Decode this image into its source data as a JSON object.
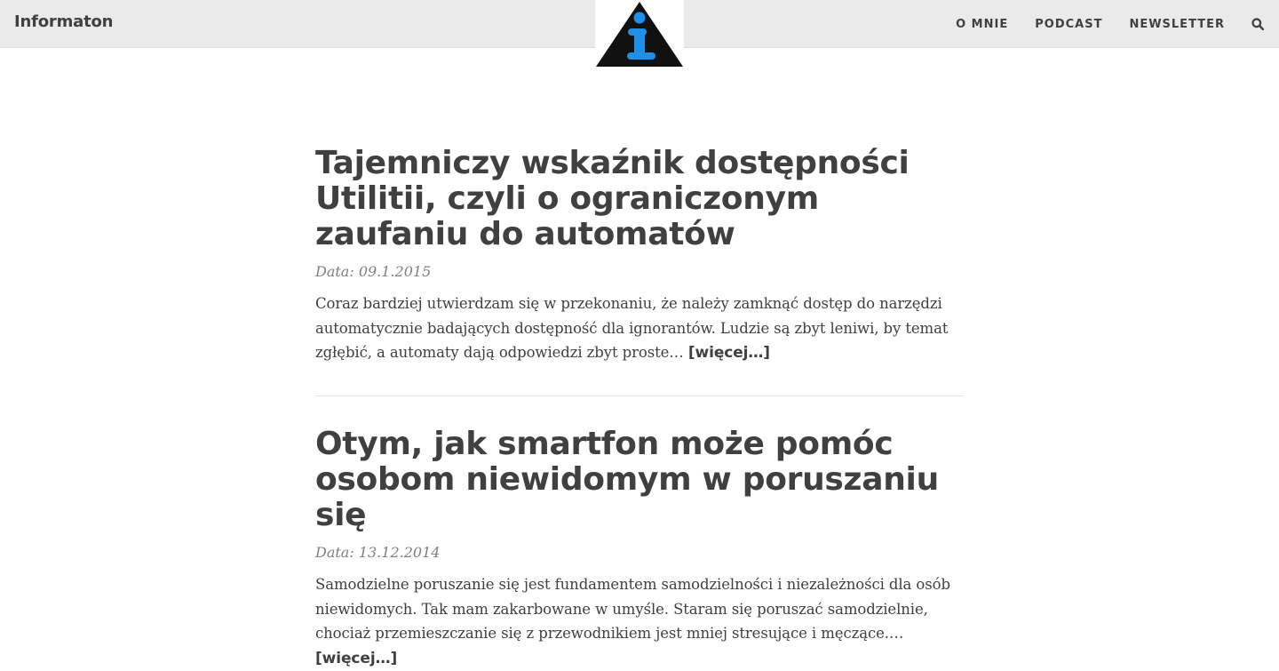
{
  "header": {
    "brand": "Informaton",
    "logo_icon": "information-triangle-icon",
    "nav": [
      {
        "label": "O MNIE"
      },
      {
        "label": "PODCAST"
      },
      {
        "label": "NEWSLETTER"
      }
    ],
    "search_icon": "search-icon"
  },
  "colors": {
    "header_bg": "#eaeaea",
    "text": "#404040",
    "meta": "#808080",
    "logo_blue": "#1f8fe8",
    "logo_black": "#111111"
  },
  "posts": [
    {
      "title": "Tajemniczy wskaźnik dostępności Utilitii, czyli o ograniczonym zaufaniu do automatów",
      "meta": "Data: 09.1.2015",
      "excerpt": "Coraz bardziej utwierdzam się w przekonaniu, że należy zamknąć dostęp do narzędzi automatycznie badających dostępność dla ignorantów. Ludzie są zbyt leniwi, by temat zgłębić, a automaty dają odpowiedzi zbyt proste…",
      "more": "[więcej…]"
    },
    {
      "title": "Otym, jak smartfon może pomóc osobom niewidomym w poruszaniu się",
      "meta": "Data: 13.12.2014",
      "excerpt": "Samodzielne poruszanie się jest fundamentem samodzielności i niezależności dla osób niewidomych. Tak mam zakarbowane w umyśle. Staram się poruszać samodzielnie, chociaż przemieszczanie się z przewodnikiem jest mniej stresujące i męczące.…",
      "more": "[więcej…]"
    }
  ]
}
